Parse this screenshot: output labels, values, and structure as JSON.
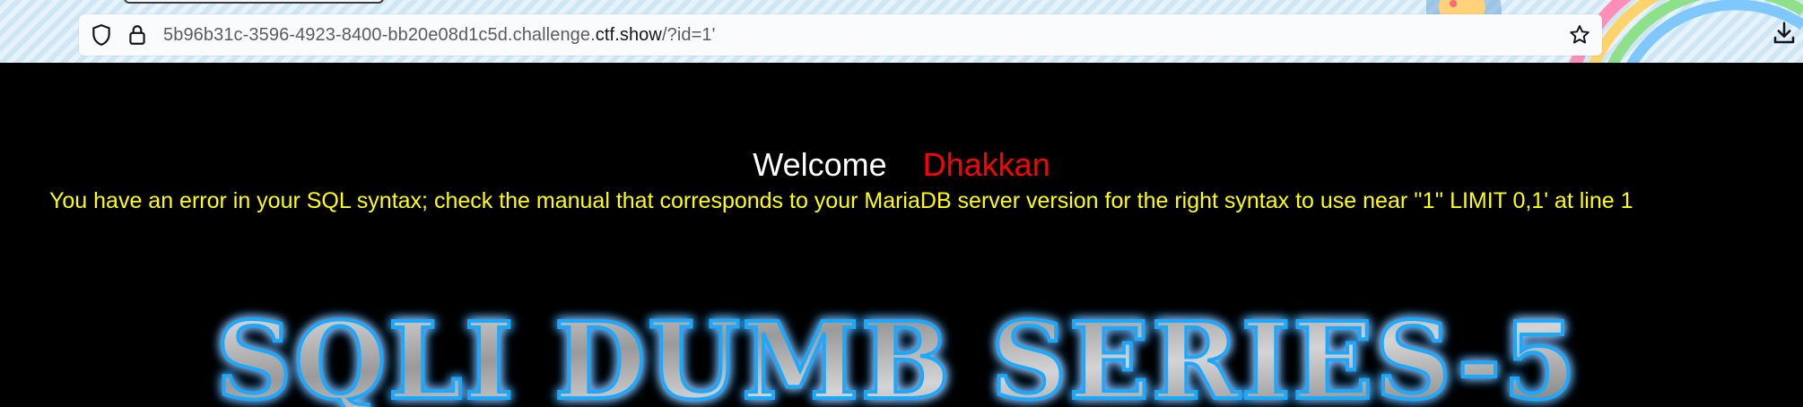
{
  "browser": {
    "url_prefix": "5b96b31c-3596-4923-8400-bb20e08d1c5d.challenge.",
    "url_domain": "ctf.show",
    "url_path": "/?id=1'"
  },
  "page": {
    "welcome_label": "Welcome",
    "welcome_name": "Dhakkan",
    "error_message": "You have an error in your SQL syntax; check the manual that corresponds to your MariaDB server version for the right syntax to use near ''1'' LIMIT 0,1' at line 1",
    "banner_text": "SQLI DUMB SERIES-5"
  },
  "colors": {
    "background": "#000000",
    "welcome": "#ffffff",
    "name": "#ff0000",
    "error": "#ffff00",
    "banner_glow": "#1ea8ff"
  }
}
